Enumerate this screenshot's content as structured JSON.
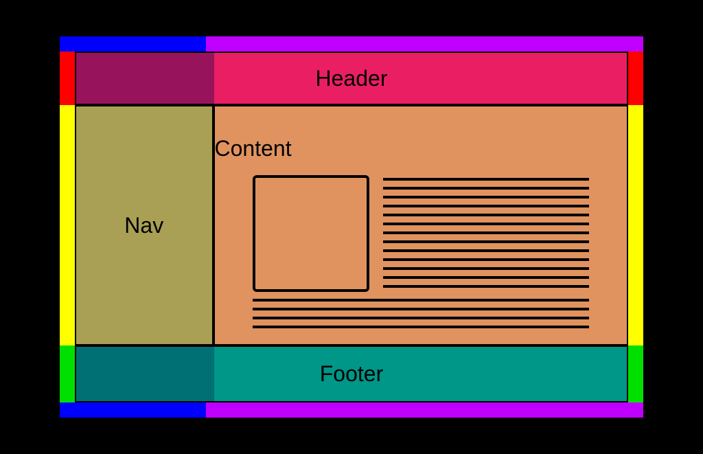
{
  "layout": {
    "header": {
      "label": "Header"
    },
    "nav": {
      "label": "Nav"
    },
    "content": {
      "label": "Content"
    },
    "footer": {
      "label": "Footer"
    }
  },
  "colors": {
    "header": "#e91e63",
    "nav": "#a9a055",
    "content": "#e0935f",
    "footer": "#009688",
    "border_top_left": "#0000ff",
    "border_top_right": "#c000ff",
    "border_side_top": "#ff0000",
    "border_side_mid": "#ffff00",
    "border_side_bot": "#00e000"
  }
}
